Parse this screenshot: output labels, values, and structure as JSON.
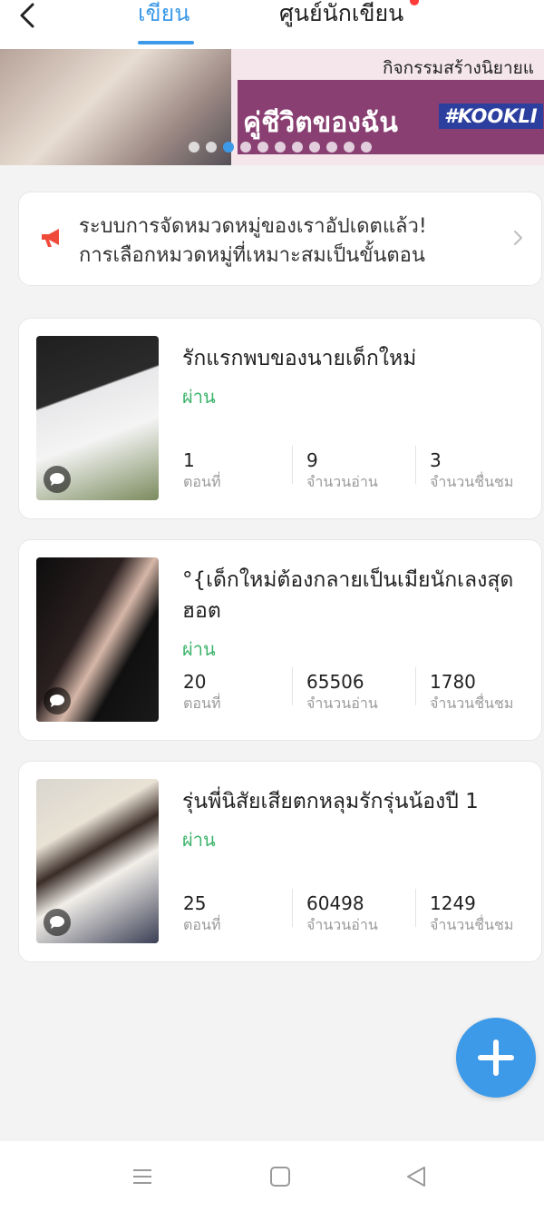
{
  "header": {
    "tabs": [
      {
        "label": "เขียน",
        "active": true
      },
      {
        "label": "ศูนย์นักเขียน",
        "active": false
      }
    ]
  },
  "banner": {
    "top_text": "กิจกรรมสร้างนิยายแ",
    "title": "คู่ชีวิตของฉัน",
    "hashtag": "#KOOKLI",
    "dot_count": 11,
    "active_dot": 2
  },
  "notice": {
    "line1": "ระบบการจัดหมวดหมู่ของเราอัปเดตแล้ว!",
    "line2": "การเลือกหมวดหมู่ที่เหมาะสมเป็นขั้นตอน"
  },
  "stat_labels": {
    "episodes": "ตอนที่",
    "reads": "จำนวนอ่าน",
    "likes": "จำนวนชื่นชม"
  },
  "works": [
    {
      "title": "รักแรกพบของนายเด็กใหม่",
      "status": "ผ่าน",
      "episodes": "1",
      "reads": "9",
      "likes": "3"
    },
    {
      "title": "°{เด็กใหม่ต้องกลายเป็นเมียนักเลงสุดฮอต",
      "status": "ผ่าน",
      "episodes": "20",
      "reads": "65506",
      "likes": "1780"
    },
    {
      "title": "รุ่นพี่นิสัยเสียตกหลุมรักรุ่นน้องปี 1",
      "status": "ผ่าน",
      "episodes": "25",
      "reads": "60498",
      "likes": "1249"
    }
  ],
  "colors": {
    "accent": "#3d9ae8",
    "status_green": "#3bb36a",
    "notice_icon": "#f04a3a"
  },
  "icons": [
    "back-arrow-icon",
    "megaphone-icon",
    "chevron-right-icon",
    "comment-bubble-icon",
    "plus-icon",
    "menu-icon",
    "home-square-icon",
    "back-triangle-icon"
  ]
}
